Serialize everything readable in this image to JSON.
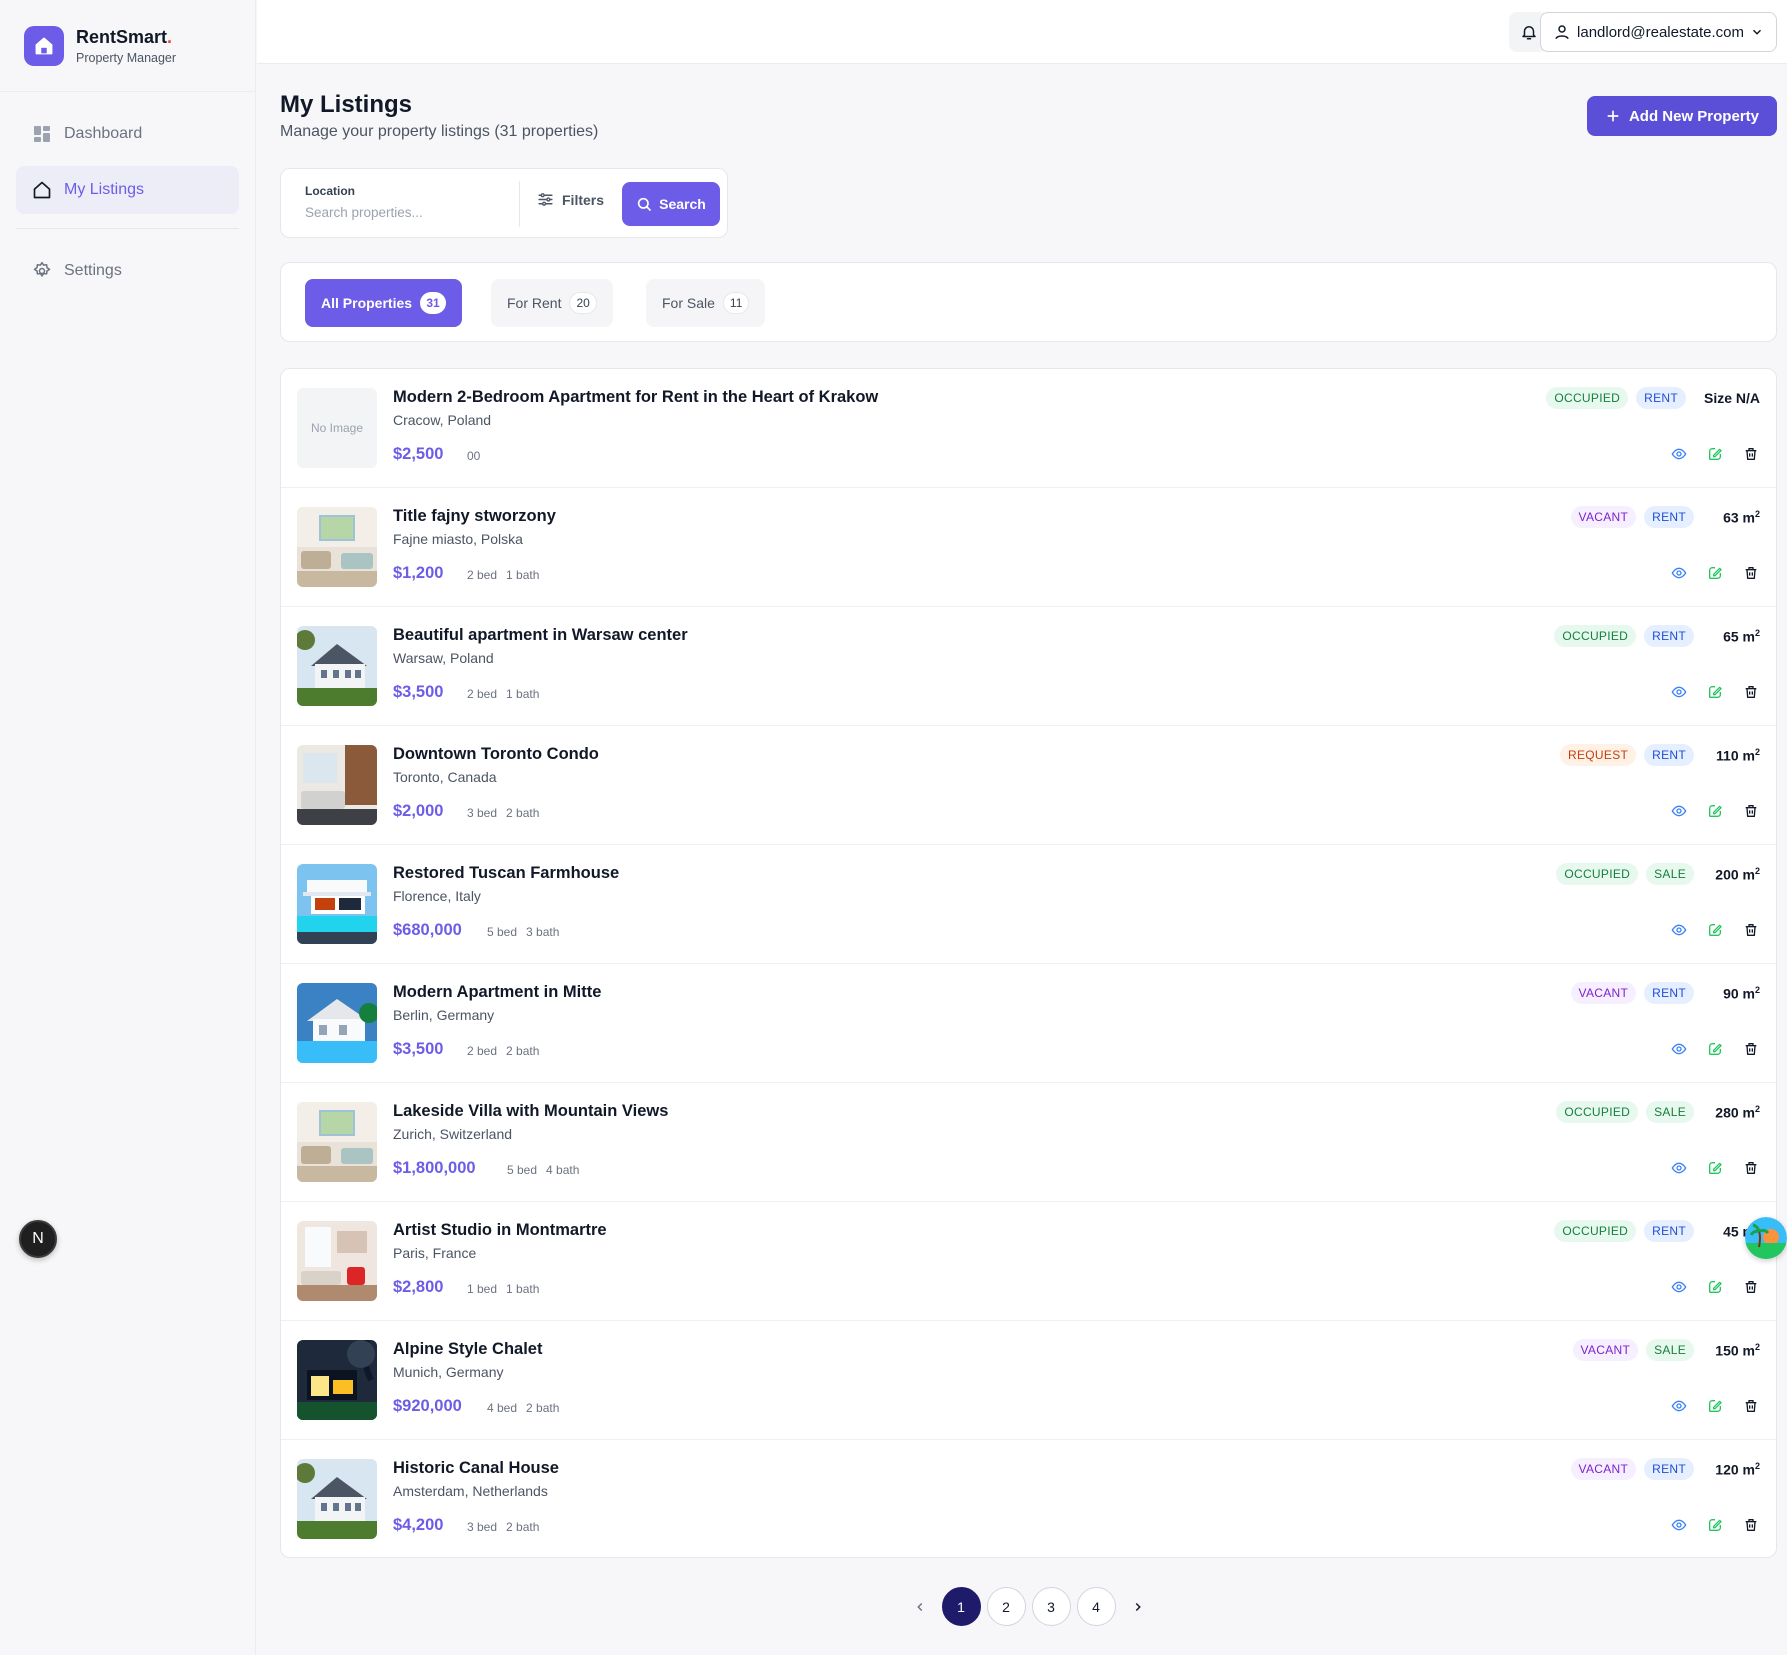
{
  "brand": {
    "name": "RentSmart",
    "dot": ".",
    "subtitle": "Property Manager"
  },
  "sidebar": {
    "items": [
      {
        "label": "Dashboard",
        "icon": "dashboard-icon"
      },
      {
        "label": "My Listings",
        "icon": "home-icon",
        "active": true
      },
      {
        "label": "Settings",
        "icon": "gear-icon"
      }
    ]
  },
  "overlay_badge": "N",
  "topbar": {
    "user_email": "landlord@realestate.com"
  },
  "page": {
    "title": "My Listings",
    "subtitle": "Manage your property listings (31 properties)",
    "add_button": "Add New Property"
  },
  "search": {
    "location_label": "Location",
    "placeholder": "Search properties...",
    "filters_label": "Filters",
    "search_label": "Search"
  },
  "tabs": [
    {
      "label": "All Properties",
      "count": "31",
      "active": true
    },
    {
      "label": "For Rent",
      "count": "20"
    },
    {
      "label": "For Sale",
      "count": "11"
    }
  ],
  "listings": [
    {
      "title": "Modern 2-Bedroom Apartment for Rent in the Heart of Krakow",
      "location": "Cracow, Poland",
      "price": "$2,500",
      "meta": [
        "00"
      ],
      "status": "OCCUPIED",
      "type": "RENT",
      "size": "Size N/A",
      "size_sup": "",
      "image": "none",
      "no_image_text": "No Image"
    },
    {
      "title": "Title fajny stworzony",
      "location": "Fajne miasto, Polska",
      "price": "$1,200",
      "meta": [
        "2 bed",
        "1 bath"
      ],
      "status": "VACANT",
      "type": "RENT",
      "size": "63 m",
      "size_sup": "2",
      "image": "living"
    },
    {
      "title": "Beautiful apartment in Warsaw center",
      "location": "Warsaw, Poland",
      "price": "$3,500",
      "meta": [
        "2 bed",
        "1 bath"
      ],
      "status": "OCCUPIED",
      "type": "RENT",
      "size": "65 m",
      "size_sup": "2",
      "image": "house"
    },
    {
      "title": "Downtown Toronto Condo",
      "location": "Toronto, Canada",
      "price": "$2,000",
      "meta": [
        "3 bed",
        "2 bath"
      ],
      "status": "REQUEST",
      "type": "RENT",
      "size": "110 m",
      "size_sup": "2",
      "image": "interior"
    },
    {
      "title": "Restored Tuscan Farmhouse",
      "location": "Florence, Italy",
      "price": "$680,000",
      "meta": [
        "5 bed",
        "3 bath"
      ],
      "status": "OCCUPIED",
      "type": "SALE",
      "size": "200 m",
      "size_sup": "2",
      "image": "villa"
    },
    {
      "title": "Modern Apartment in Mitte",
      "location": "Berlin, Germany",
      "price": "$3,500",
      "meta": [
        "2 bed",
        "2 bath"
      ],
      "status": "VACANT",
      "type": "RENT",
      "size": "90 m",
      "size_sup": "2",
      "image": "pool"
    },
    {
      "title": "Lakeside Villa with Mountain Views",
      "location": "Zurich, Switzerland",
      "price": "$1,800,000",
      "meta": [
        "5 bed",
        "4 bath"
      ],
      "status": "OCCUPIED",
      "type": "SALE",
      "size": "280 m",
      "size_sup": "2",
      "image": "living"
    },
    {
      "title": "Artist Studio in Montmartre",
      "location": "Paris, France",
      "price": "$2,800",
      "meta": [
        "1 bed",
        "1 bath"
      ],
      "status": "OCCUPIED",
      "type": "RENT",
      "size": "45 m",
      "size_sup": "2",
      "image": "studio"
    },
    {
      "title": "Alpine Style Chalet",
      "location": "Munich, Germany",
      "price": "$920,000",
      "meta": [
        "4 bed",
        "2 bath"
      ],
      "status": "VACANT",
      "type": "SALE",
      "size": "150 m",
      "size_sup": "2",
      "image": "night"
    },
    {
      "title": "Historic Canal House",
      "location": "Amsterdam, Netherlands",
      "price": "$4,200",
      "meta": [
        "3 bed",
        "2 bath"
      ],
      "status": "VACANT",
      "type": "RENT",
      "size": "120 m",
      "size_sup": "2",
      "image": "house"
    }
  ],
  "pagination": {
    "pages": [
      "1",
      "2",
      "3",
      "4"
    ],
    "current": "1"
  },
  "colors": {
    "accent": "#6c5ce7",
    "page_active": "#1e1b6b",
    "occupied": "#15803d",
    "vacant": "#7e22ce",
    "request": "#c2410c",
    "rent": "#1d4ed8"
  }
}
